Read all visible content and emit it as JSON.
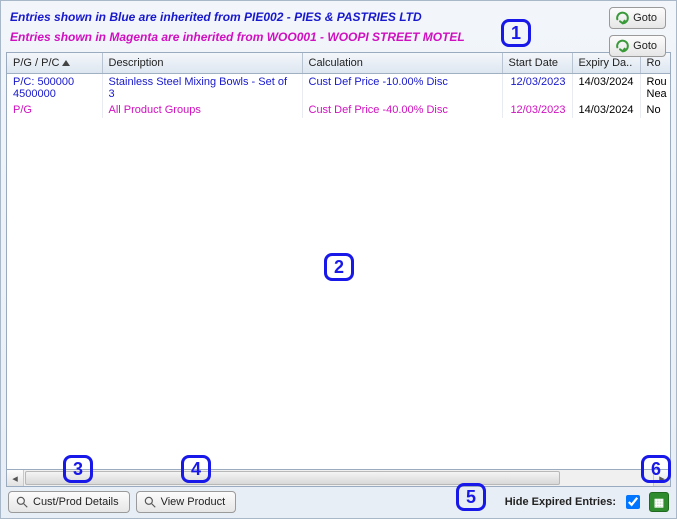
{
  "info": {
    "line1": "Entries shown in Blue are inherited from PIE002 - PIES & PASTRIES LTD",
    "line2": "Entries shown in Magenta are inherited from WOO001 - WOOPI STREET MOTEL"
  },
  "buttons": {
    "goto": "Goto",
    "cust_prod": "Cust/Prod Details",
    "view_product": "View Product"
  },
  "callouts": {
    "c1": "1",
    "c2": "2",
    "c3": "3",
    "c4": "4",
    "c5": "5",
    "c6": "6"
  },
  "table": {
    "headers": {
      "pgpc": "P/G / P/C",
      "desc": "Description",
      "calc": "Calculation",
      "start": "Start Date",
      "expiry": "Expiry Da..",
      "round": "Ro"
    },
    "rows": [
      {
        "color": "blue",
        "pgpc_l1": "P/C: 500000",
        "pgpc_l2": "4500000",
        "desc": "Stainless Steel Mixing Bowls - Set of 3",
        "calc": "Cust Def Price -10.00% Disc",
        "start": "12/03/2023",
        "expiry": "14/03/2024",
        "round": "Rou Nea"
      },
      {
        "color": "magenta",
        "pgpc_l1": "P/G",
        "pgpc_l2": "",
        "desc": "All Product Groups",
        "calc": "Cust Def Price -40.00% Disc",
        "start": "12/03/2023",
        "expiry": "14/03/2024",
        "round": "No"
      }
    ]
  },
  "footer": {
    "hide_label": "Hide Expired Entries:",
    "hide_checked": true
  }
}
